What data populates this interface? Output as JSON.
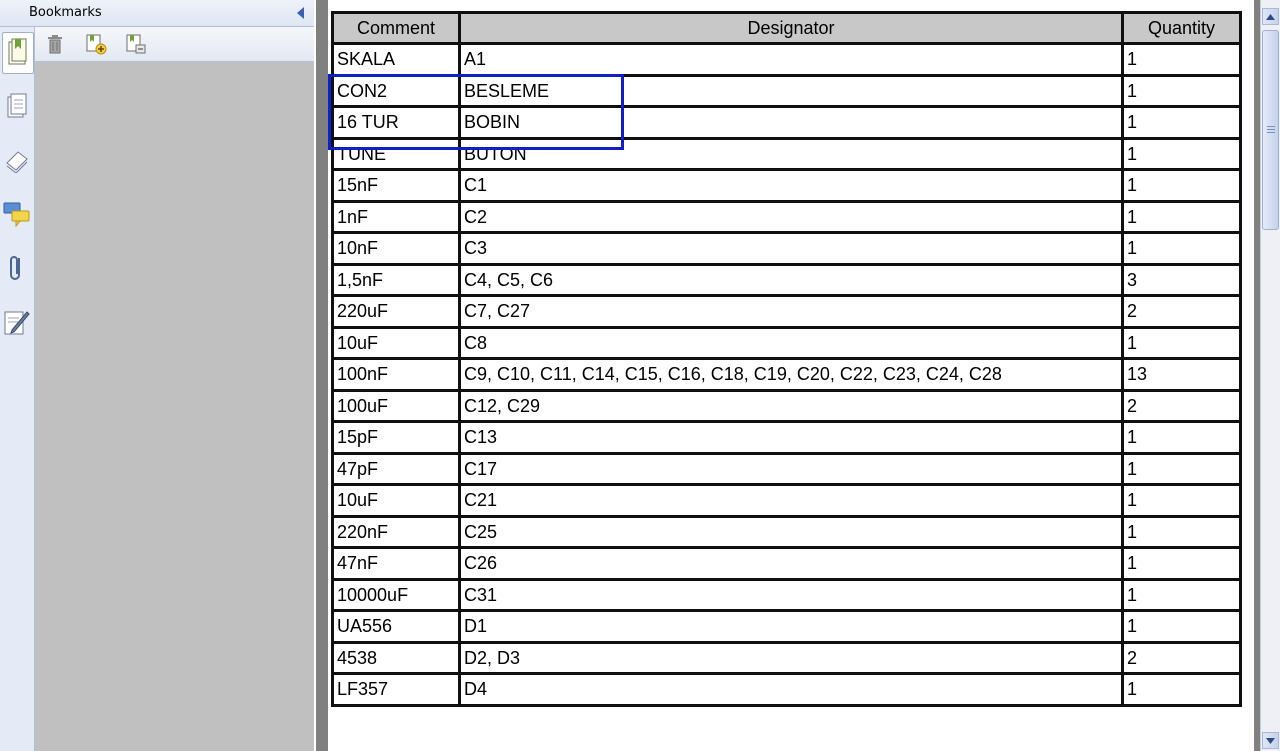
{
  "bookmarks_panel": {
    "title": "Bookmarks",
    "toolbar": [
      "delete-icon",
      "new-bookmark-icon",
      "expand-bookmark-icon"
    ]
  },
  "nav_icons": [
    "bookmarks-icon",
    "pages-icon",
    "layers-icon",
    "comments-icon",
    "attachments-icon",
    "signatures-icon"
  ],
  "colors": {
    "highlight_border": "#1020c8",
    "table_header_bg": "#c8c8c8",
    "doc_background": "#808080"
  },
  "table": {
    "headers": [
      "Comment",
      "Designator",
      "Quantity"
    ],
    "rows": [
      [
        "SKALA",
        "A1",
        "1"
      ],
      [
        "CON2",
        "BESLEME",
        "1"
      ],
      [
        "16 TUR",
        "BOBIN",
        "1"
      ],
      [
        "TUNE",
        "BUTON",
        "1"
      ],
      [
        "15nF",
        "C1",
        "1"
      ],
      [
        "1nF",
        "C2",
        "1"
      ],
      [
        "10nF",
        "C3",
        "1"
      ],
      [
        "1,5nF",
        "C4, C5, C6",
        "3"
      ],
      [
        "220uF",
        "C7, C27",
        "2"
      ],
      [
        "10uF",
        "C8",
        "1"
      ],
      [
        "100nF",
        "C9, C10, C11, C14, C15, C16, C18, C19, C20, C22, C23, C24, C28",
        "13"
      ],
      [
        "100uF",
        "C12, C29",
        "2"
      ],
      [
        "15pF",
        "C13",
        "1"
      ],
      [
        "47pF",
        "C17",
        "1"
      ],
      [
        "10uF",
        "C21",
        "1"
      ],
      [
        "220nF",
        "C25",
        "1"
      ],
      [
        "47nF",
        "C26",
        "1"
      ],
      [
        "10000uF",
        "C31",
        "1"
      ],
      [
        "UA556",
        "D1",
        "1"
      ],
      [
        "4538",
        "D2, D3",
        "2"
      ],
      [
        "LF357",
        "D4",
        "1"
      ]
    ]
  }
}
